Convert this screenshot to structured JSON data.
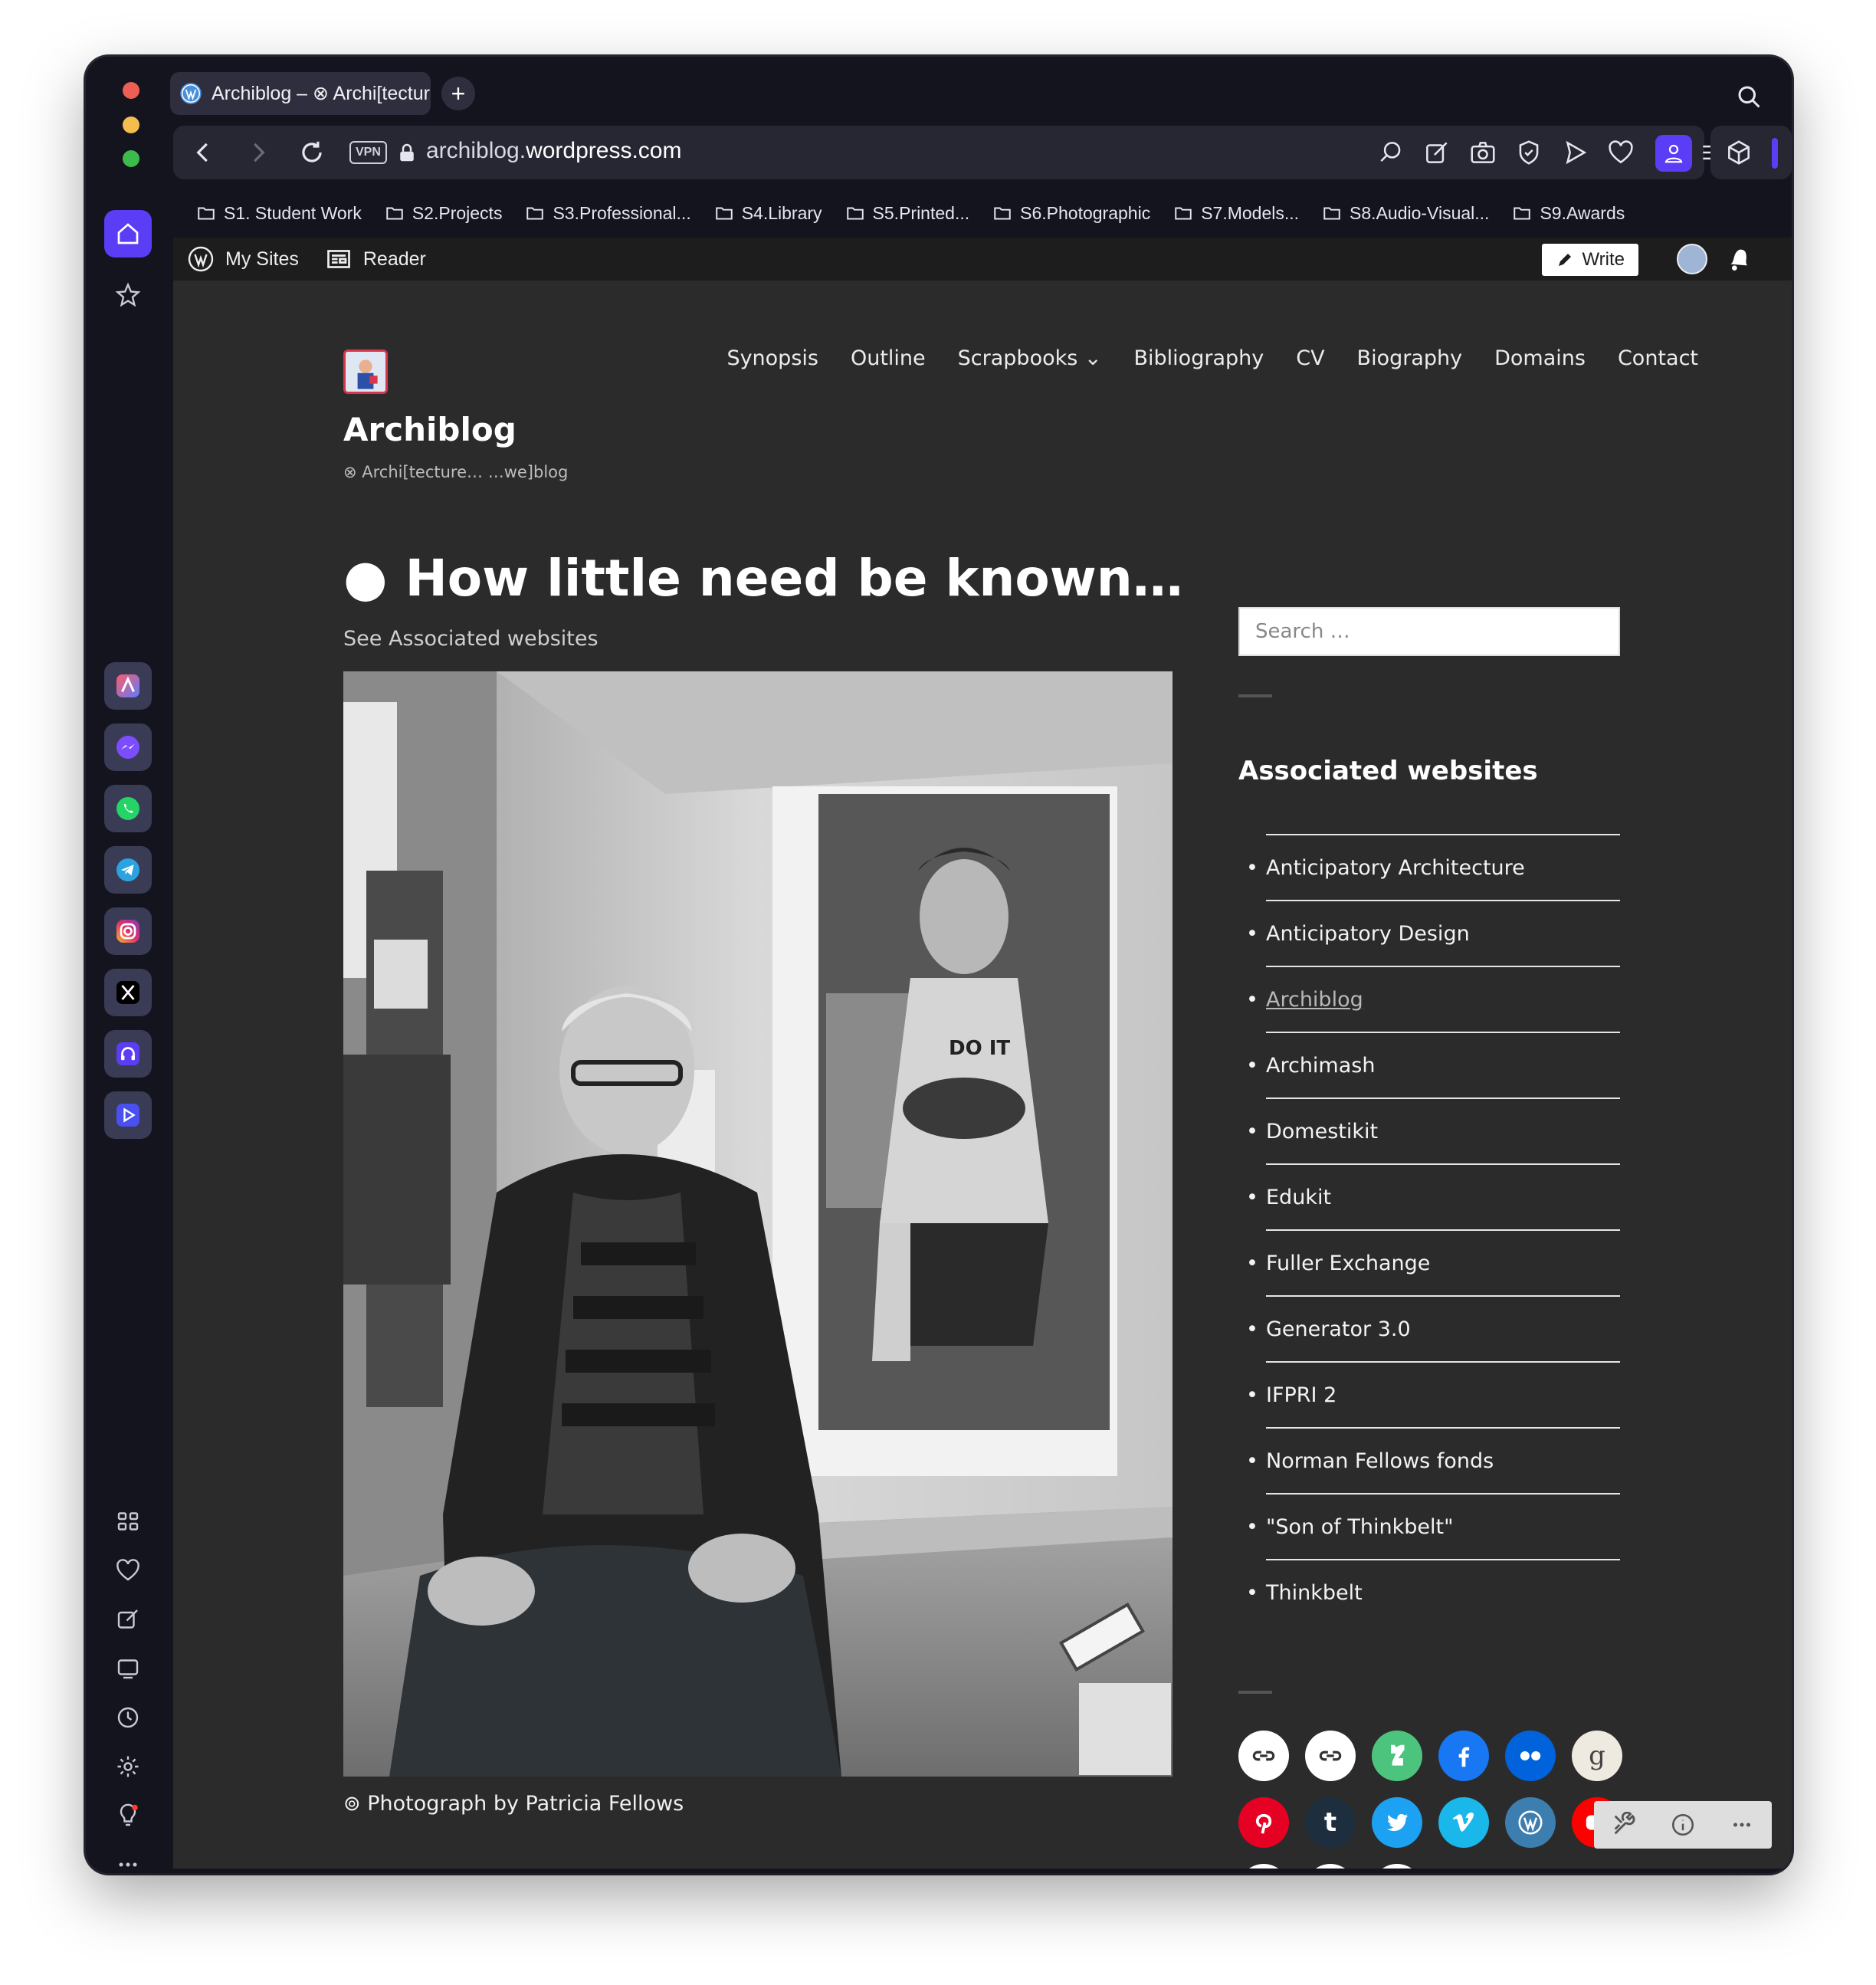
{
  "browser": {
    "tab_title": "Archiblog – ⊗ Archi[tecture",
    "new_tab_label": "+",
    "vpn_badge": "VPN",
    "url_prefix": "archiblog.",
    "url_domain": "wordpress.com",
    "icons": [
      "back-icon",
      "forward-icon",
      "reload-icon",
      "lock-icon",
      "search-icon",
      "edit-icon",
      "camera-icon",
      "shield-icon",
      "send-icon",
      "heart-icon",
      "download-icon",
      "menu-icon",
      "profile-icon",
      "cube-icon"
    ]
  },
  "bookmarks": [
    "S1. Student Work",
    "S2.Projects",
    "S3.Professional...",
    "S4.Library",
    "S5.Printed...",
    "S6.Photographic",
    "S7.Models...",
    "S8.Audio-Visual...",
    "S9.Awards"
  ],
  "wp_admin": {
    "my_sites": "My Sites",
    "reader": "Reader",
    "write": "Write"
  },
  "site": {
    "title": "Archiblog",
    "tagline": "⊗ Archi[tecture… …we]blog",
    "nav": [
      "Synopsis",
      "Outline",
      "Scrapbooks ⌄",
      "Bibliography",
      "CV",
      "Biography",
      "Domains",
      "Contact"
    ]
  },
  "post": {
    "title": "● How little need be known…",
    "subtitle": "See Associated websites",
    "caption": "⊚ Photograph by Patricia Fellows",
    "photo_shirt_text": "DO IT"
  },
  "sidebar": {
    "search_placeholder": "Search …",
    "widget_title": "Associated websites",
    "links": [
      "Anticipatory Architecture",
      "Anticipatory Design",
      "Archiblog",
      "Archimash",
      "Domestikit",
      "Edukit",
      "Fuller Exchange",
      "Generator 3.0",
      "IFPRI 2",
      "Norman Fellows fonds",
      "\"Son of Thinkbelt\"",
      "Thinkbelt"
    ],
    "current_link_index": 2
  },
  "social": {
    "tumblr": "t",
    "goodreads": "g",
    "colors": {
      "link": "#ffffff",
      "deviantart": "#4dc47d",
      "facebook": "#1877f2",
      "flickr": "#0063db",
      "goodreads": "#eeeadf",
      "pinterest": "#e60023",
      "tumblr": "#1d2f3f",
      "twitter": "#1da1f2",
      "vimeo": "#1ab7ea",
      "wordpress": "#3d7eb0",
      "youtube": "#ff0000"
    }
  },
  "colors": {
    "accent": "#5b3df5",
    "page_bg": "#2b2b2b",
    "window_bg": "#14141f"
  }
}
